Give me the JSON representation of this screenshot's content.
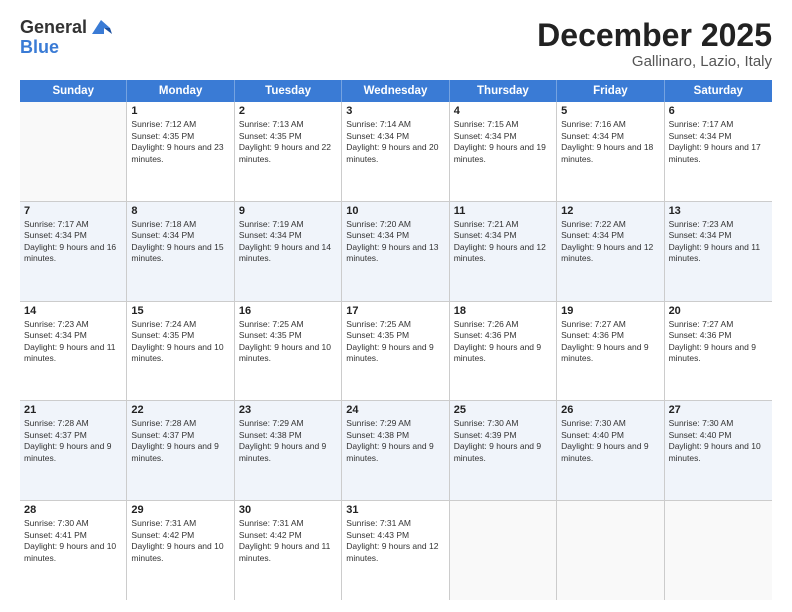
{
  "logo": {
    "general": "General",
    "blue": "Blue"
  },
  "title": "December 2025",
  "subtitle": "Gallinaro, Lazio, Italy",
  "days_of_week": [
    "Sunday",
    "Monday",
    "Tuesday",
    "Wednesday",
    "Thursday",
    "Friday",
    "Saturday"
  ],
  "weeks": [
    [
      {
        "day": null,
        "sunrise": null,
        "sunset": null,
        "daylight": null
      },
      {
        "day": "1",
        "sunrise": "Sunrise: 7:12 AM",
        "sunset": "Sunset: 4:35 PM",
        "daylight": "Daylight: 9 hours and 23 minutes."
      },
      {
        "day": "2",
        "sunrise": "Sunrise: 7:13 AM",
        "sunset": "Sunset: 4:35 PM",
        "daylight": "Daylight: 9 hours and 22 minutes."
      },
      {
        "day": "3",
        "sunrise": "Sunrise: 7:14 AM",
        "sunset": "Sunset: 4:34 PM",
        "daylight": "Daylight: 9 hours and 20 minutes."
      },
      {
        "day": "4",
        "sunrise": "Sunrise: 7:15 AM",
        "sunset": "Sunset: 4:34 PM",
        "daylight": "Daylight: 9 hours and 19 minutes."
      },
      {
        "day": "5",
        "sunrise": "Sunrise: 7:16 AM",
        "sunset": "Sunset: 4:34 PM",
        "daylight": "Daylight: 9 hours and 18 minutes."
      },
      {
        "day": "6",
        "sunrise": "Sunrise: 7:17 AM",
        "sunset": "Sunset: 4:34 PM",
        "daylight": "Daylight: 9 hours and 17 minutes."
      }
    ],
    [
      {
        "day": "7",
        "sunrise": "Sunrise: 7:17 AM",
        "sunset": "Sunset: 4:34 PM",
        "daylight": "Daylight: 9 hours and 16 minutes."
      },
      {
        "day": "8",
        "sunrise": "Sunrise: 7:18 AM",
        "sunset": "Sunset: 4:34 PM",
        "daylight": "Daylight: 9 hours and 15 minutes."
      },
      {
        "day": "9",
        "sunrise": "Sunrise: 7:19 AM",
        "sunset": "Sunset: 4:34 PM",
        "daylight": "Daylight: 9 hours and 14 minutes."
      },
      {
        "day": "10",
        "sunrise": "Sunrise: 7:20 AM",
        "sunset": "Sunset: 4:34 PM",
        "daylight": "Daylight: 9 hours and 13 minutes."
      },
      {
        "day": "11",
        "sunrise": "Sunrise: 7:21 AM",
        "sunset": "Sunset: 4:34 PM",
        "daylight": "Daylight: 9 hours and 12 minutes."
      },
      {
        "day": "12",
        "sunrise": "Sunrise: 7:22 AM",
        "sunset": "Sunset: 4:34 PM",
        "daylight": "Daylight: 9 hours and 12 minutes."
      },
      {
        "day": "13",
        "sunrise": "Sunrise: 7:23 AM",
        "sunset": "Sunset: 4:34 PM",
        "daylight": "Daylight: 9 hours and 11 minutes."
      }
    ],
    [
      {
        "day": "14",
        "sunrise": "Sunrise: 7:23 AM",
        "sunset": "Sunset: 4:34 PM",
        "daylight": "Daylight: 9 hours and 11 minutes."
      },
      {
        "day": "15",
        "sunrise": "Sunrise: 7:24 AM",
        "sunset": "Sunset: 4:35 PM",
        "daylight": "Daylight: 9 hours and 10 minutes."
      },
      {
        "day": "16",
        "sunrise": "Sunrise: 7:25 AM",
        "sunset": "Sunset: 4:35 PM",
        "daylight": "Daylight: 9 hours and 10 minutes."
      },
      {
        "day": "17",
        "sunrise": "Sunrise: 7:25 AM",
        "sunset": "Sunset: 4:35 PM",
        "daylight": "Daylight: 9 hours and 9 minutes."
      },
      {
        "day": "18",
        "sunrise": "Sunrise: 7:26 AM",
        "sunset": "Sunset: 4:36 PM",
        "daylight": "Daylight: 9 hours and 9 minutes."
      },
      {
        "day": "19",
        "sunrise": "Sunrise: 7:27 AM",
        "sunset": "Sunset: 4:36 PM",
        "daylight": "Daylight: 9 hours and 9 minutes."
      },
      {
        "day": "20",
        "sunrise": "Sunrise: 7:27 AM",
        "sunset": "Sunset: 4:36 PM",
        "daylight": "Daylight: 9 hours and 9 minutes."
      }
    ],
    [
      {
        "day": "21",
        "sunrise": "Sunrise: 7:28 AM",
        "sunset": "Sunset: 4:37 PM",
        "daylight": "Daylight: 9 hours and 9 minutes."
      },
      {
        "day": "22",
        "sunrise": "Sunrise: 7:28 AM",
        "sunset": "Sunset: 4:37 PM",
        "daylight": "Daylight: 9 hours and 9 minutes."
      },
      {
        "day": "23",
        "sunrise": "Sunrise: 7:29 AM",
        "sunset": "Sunset: 4:38 PM",
        "daylight": "Daylight: 9 hours and 9 minutes."
      },
      {
        "day": "24",
        "sunrise": "Sunrise: 7:29 AM",
        "sunset": "Sunset: 4:38 PM",
        "daylight": "Daylight: 9 hours and 9 minutes."
      },
      {
        "day": "25",
        "sunrise": "Sunrise: 7:30 AM",
        "sunset": "Sunset: 4:39 PM",
        "daylight": "Daylight: 9 hours and 9 minutes."
      },
      {
        "day": "26",
        "sunrise": "Sunrise: 7:30 AM",
        "sunset": "Sunset: 4:40 PM",
        "daylight": "Daylight: 9 hours and 9 minutes."
      },
      {
        "day": "27",
        "sunrise": "Sunrise: 7:30 AM",
        "sunset": "Sunset: 4:40 PM",
        "daylight": "Daylight: 9 hours and 10 minutes."
      }
    ],
    [
      {
        "day": "28",
        "sunrise": "Sunrise: 7:30 AM",
        "sunset": "Sunset: 4:41 PM",
        "daylight": "Daylight: 9 hours and 10 minutes."
      },
      {
        "day": "29",
        "sunrise": "Sunrise: 7:31 AM",
        "sunset": "Sunset: 4:42 PM",
        "daylight": "Daylight: 9 hours and 10 minutes."
      },
      {
        "day": "30",
        "sunrise": "Sunrise: 7:31 AM",
        "sunset": "Sunset: 4:42 PM",
        "daylight": "Daylight: 9 hours and 11 minutes."
      },
      {
        "day": "31",
        "sunrise": "Sunrise: 7:31 AM",
        "sunset": "Sunset: 4:43 PM",
        "daylight": "Daylight: 9 hours and 12 minutes."
      },
      {
        "day": null,
        "sunrise": null,
        "sunset": null,
        "daylight": null
      },
      {
        "day": null,
        "sunrise": null,
        "sunset": null,
        "daylight": null
      },
      {
        "day": null,
        "sunrise": null,
        "sunset": null,
        "daylight": null
      }
    ]
  ]
}
